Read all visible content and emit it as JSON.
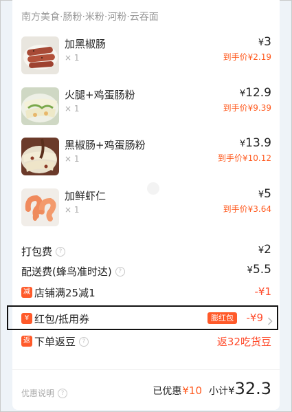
{
  "store_title": "南方美食·肠粉·米粉·河粉·云吞面",
  "currency": "¥",
  "items": [
    {
      "name": "加黑椒肠",
      "qty": "× 1",
      "price": "3",
      "final_label": "到手价",
      "final_price": "2.19"
    },
    {
      "name": "火腿+鸡蛋肠粉",
      "qty": "× 1",
      "price": "12.9",
      "final_label": "到手价",
      "final_price": "9.39"
    },
    {
      "name": "黑椒肠+鸡蛋肠粉",
      "qty": "× 1",
      "price": "13.9",
      "final_label": "到手价",
      "final_price": "10.12"
    },
    {
      "name": "加鲜虾仁",
      "qty": "× 1",
      "price": "5",
      "final_label": "到手价",
      "final_price": "3.64"
    }
  ],
  "fees": {
    "packing_label": "打包费",
    "packing_value": "2",
    "delivery_label": "配送费(蜂鸟准时达)",
    "delivery_value": "5.5"
  },
  "discounts": {
    "store_badge": "减",
    "store_label": "店铺满25减1",
    "store_value": "-¥1",
    "coupon_badge": "¥",
    "coupon_label": "红包/抵用券",
    "coupon_tag": "膨红包",
    "coupon_value": "-¥9",
    "return_badge": "返",
    "return_label": "下单返豆",
    "return_value": "返32吃货豆"
  },
  "footer": {
    "note_label": "优惠说明",
    "saved_label": "已优惠",
    "saved_value": "¥10",
    "subtotal_label": "小计",
    "subtotal_currency": "¥",
    "subtotal_value": "32.3"
  },
  "colors": {
    "accent": "#ff5a1f",
    "badge": "#ff5a2a"
  },
  "icons": [
    "question-icon",
    "chevron-right-icon"
  ]
}
